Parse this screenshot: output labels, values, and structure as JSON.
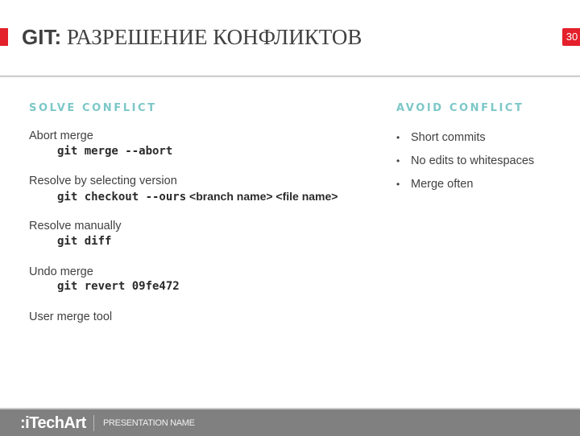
{
  "header": {
    "title_prefix": "GIT:",
    "title_rest": " РАЗРЕШЕНИЕ КОНФЛИКТОВ",
    "page_number": "30",
    "accent_color": "#e3202b"
  },
  "solve": {
    "heading": "SOLVE CONFLICT",
    "items": [
      {
        "label": "Abort merge",
        "command": "git merge --abort",
        "args": ""
      },
      {
        "label": "Resolve by selecting version",
        "command": "git checkout --ours",
        "args": " <branch name> <file name>"
      },
      {
        "label": "Resolve manually",
        "command": "git diff",
        "args": ""
      },
      {
        "label": "Undo merge",
        "command": "git revert 09fe472",
        "args": ""
      },
      {
        "label": "User merge tool",
        "command": "",
        "args": ""
      }
    ]
  },
  "avoid": {
    "heading": "AVOID CONFLICT",
    "bullets": [
      "Short commits",
      "No edits to whitespaces",
      "Merge often"
    ]
  },
  "footer": {
    "logo": ":iTechArt",
    "presentation_name": "PRESENTATION NAME"
  },
  "colors": {
    "heading_teal": "#7cc7c8",
    "footer_gray": "#808080"
  }
}
